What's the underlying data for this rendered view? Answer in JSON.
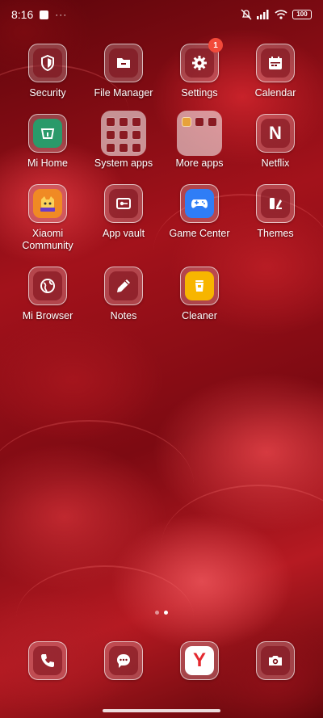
{
  "status_bar": {
    "time": "8:16",
    "dots": "···",
    "battery": "100"
  },
  "apps": [
    {
      "label": "Security",
      "icon": "shield-icon"
    },
    {
      "label": "File Manager",
      "icon": "folder-icon"
    },
    {
      "label": "Settings",
      "icon": "gear-icon",
      "badge": "1"
    },
    {
      "label": "Calendar",
      "icon": "calendar-icon"
    },
    {
      "label": "Mi Home",
      "icon": "mi-home-icon"
    },
    {
      "label": "System apps",
      "icon": "folder-grid"
    },
    {
      "label": "More apps",
      "icon": "folder-grid"
    },
    {
      "label": "Netflix",
      "icon": "netflix-icon",
      "glyph": "N"
    },
    {
      "label": "Xiaomi Community",
      "icon": "community-icon"
    },
    {
      "label": "App vault",
      "icon": "vault-icon"
    },
    {
      "label": "Game Center",
      "icon": "gamepad-icon"
    },
    {
      "label": "Themes",
      "icon": "themes-icon"
    },
    {
      "label": "Mi Browser",
      "icon": "globe-icon"
    },
    {
      "label": "Notes",
      "icon": "pencil-icon"
    },
    {
      "label": "Cleaner",
      "icon": "trash-icon"
    }
  ],
  "dock": [
    {
      "name": "phone",
      "icon": "phone-icon"
    },
    {
      "name": "messages",
      "icon": "message-icon"
    },
    {
      "name": "yandex-browser",
      "icon": "yandex-icon",
      "glyph": "Y"
    },
    {
      "name": "camera",
      "icon": "camera-icon"
    }
  ],
  "colors": {
    "badge": "#f24a3a",
    "netflix": "#e50914",
    "game_center": "#2f7df6",
    "cleaner": "#f7b500",
    "yandex": "#e4282e"
  }
}
